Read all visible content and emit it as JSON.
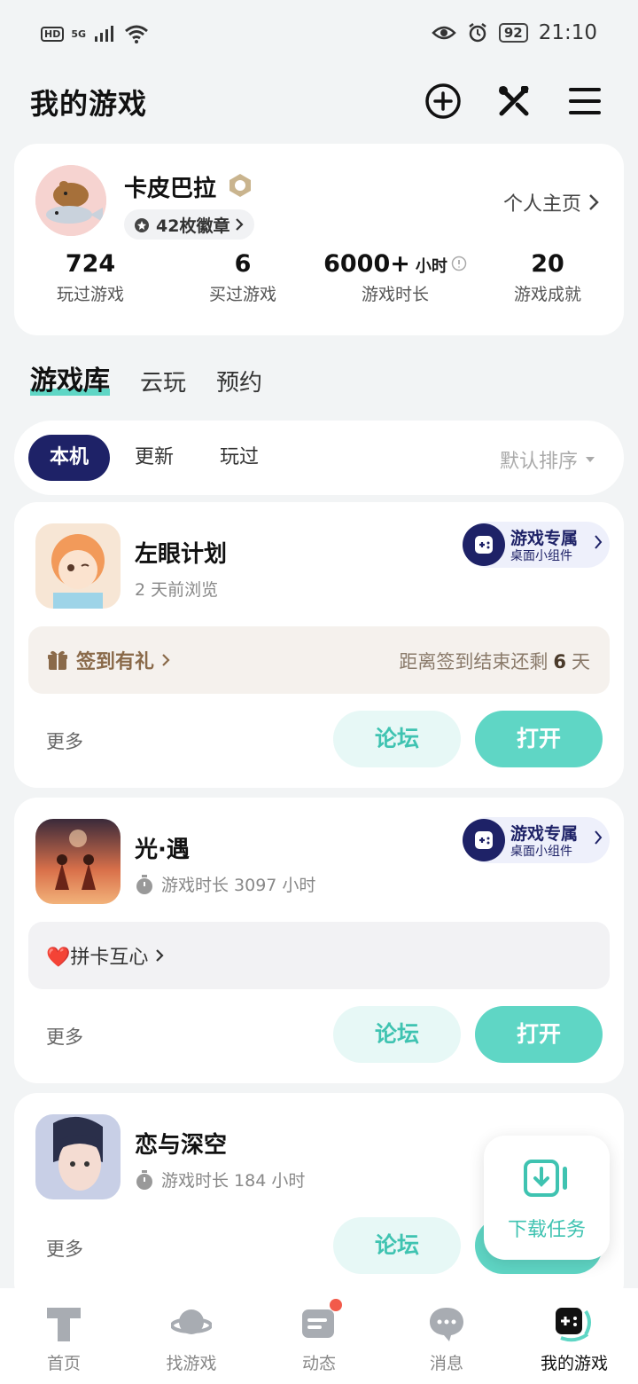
{
  "status_bar": {
    "hd": "HD",
    "network": "5G",
    "battery": "92",
    "time": "21:10"
  },
  "header": {
    "title": "我的游戏",
    "add_icon": "plus-circle-icon",
    "tools_icon": "tools-icon",
    "menu_icon": "menu-icon"
  },
  "profile": {
    "name": "卡皮巴拉",
    "badges": "42枚徽章",
    "homepage_link": "个人主页",
    "stats": [
      {
        "value": "724",
        "unit": "",
        "label": "玩过游戏"
      },
      {
        "value": "6",
        "unit": "",
        "label": "买过游戏"
      },
      {
        "value": "6000+",
        "unit": "小时",
        "label": "游戏时长"
      },
      {
        "value": "20",
        "unit": "",
        "label": "游戏成就"
      }
    ]
  },
  "main_tabs": [
    "游戏库",
    "云玩",
    "预约"
  ],
  "filters": {
    "tabs": [
      "本机",
      "更新",
      "玩过"
    ],
    "sort": "默认排序"
  },
  "widget": {
    "line1": "游戏专属",
    "line2": "桌面小组件"
  },
  "games": [
    {
      "name": "左眼计划",
      "sub": "2 天前浏览",
      "banner_left": "签到有礼",
      "banner_right_prefix": "距离签到结束还剩",
      "banner_right_num": "6",
      "banner_right_suffix": "天",
      "more": "更多",
      "forum": "论坛",
      "open": "打开"
    },
    {
      "name": "光·遇",
      "sub": "游戏时长 3097 小时",
      "banner_left": "❤️拼卡互心",
      "more": "更多",
      "forum": "论坛",
      "open": "打开"
    },
    {
      "name": "恋与深空",
      "sub": "游戏时长 184 小时",
      "more": "更多",
      "forum": "论坛",
      "open": "打开"
    }
  ],
  "download": {
    "label": "下载任务"
  },
  "bottom_nav": [
    {
      "label": "首页"
    },
    {
      "label": "找游戏"
    },
    {
      "label": "动态"
    },
    {
      "label": "消息"
    },
    {
      "label": "我的游戏"
    }
  ],
  "colors": {
    "accent": "#5fd6c5",
    "navy": "#1e2267",
    "background": "#f2f4f5"
  }
}
